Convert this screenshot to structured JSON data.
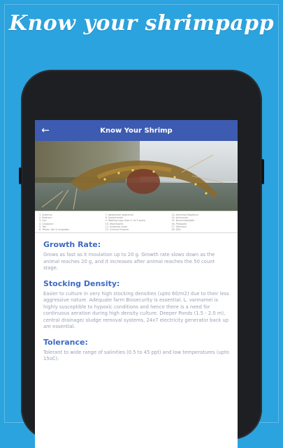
{
  "promo": {
    "title": "Know your shrimpapp"
  },
  "colors": {
    "background": "#2ba3df",
    "appbar": "#3d5bb0",
    "heading": "#3d6bc2",
    "body_text": "#9aa0b6"
  },
  "appbar": {
    "back_icon": "arrow-left-icon",
    "back_glyph": "←",
    "title": "Know Your Shrimp"
  },
  "hero": {
    "image": "shrimp-photo"
  },
  "legend": {
    "columns": [
      [
        "1. Antenna",
        "2. Rostrum",
        "3. Eye",
        "4. Carapace",
        "5. Tail",
        "6. Telson, tail & uropodes"
      ],
      [
        "7. Abdominal segments",
        "8. Swimmerets",
        "9. Walking legs (from 1 to 5 pairs)",
        "10. Mouthparts",
        "11. Antennal scale",
        "12. Cervical Groove"
      ],
      [
        "13. Antennal flagellum",
        "14. Antennule",
        "15. Branchiostegite",
        "16. Pleopods",
        "17. Stomach",
        "18. Gills"
      ]
    ]
  },
  "sections": [
    {
      "heading": "Growth Rate:",
      "body": "Grows as fast as it moulation up to 20 g. Growth rate slows down as the animal reaches 20 g, and it increases after animal reaches the 50 count stage."
    },
    {
      "heading": "Stocking Density:",
      "body": "Easier to culture in very high stocking densities (upto 60/m2) due to their less aggressive nature. Adequate farm Biosecurity is essential. L. vannamei is highly susceptible to hypoxic conditions and hence there is a need for continuous aeration during high density culture. Deeper Ponds (1.5 - 2.0 m), central drainage/ sludge removal systems, 24x7 electricity generator back up are essential."
    },
    {
      "heading": "Tolerance:",
      "body": "Tolerant to wide range of salinities (0.5 to 45 ppt) and low temperatures (upto 15oC)."
    }
  ]
}
